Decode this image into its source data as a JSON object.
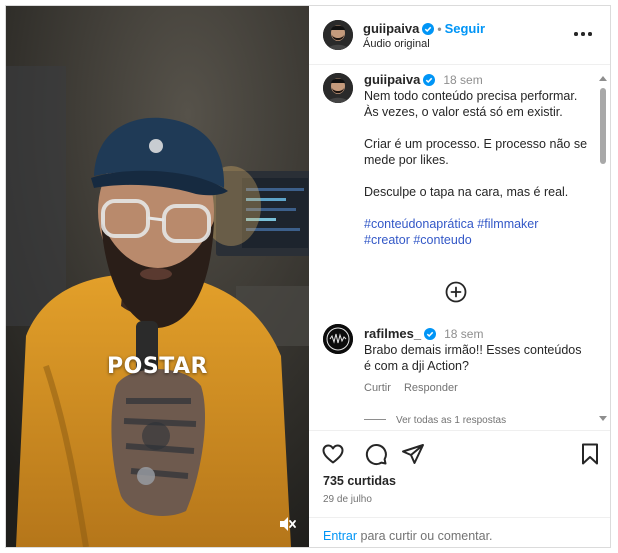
{
  "header": {
    "username": "guiipaiva",
    "separator": "•",
    "follow_label": "Seguir",
    "audio": "Áudio original"
  },
  "media": {
    "overlay_text": "POSTAR"
  },
  "caption": {
    "username": "guiipaiva",
    "time": "18 sem",
    "lines1": [
      "Nem todo conteúdo precisa performar.",
      "Às vezes, o valor está só em existir."
    ],
    "lines2": [
      "Criar é um processo. E processo não se",
      "mede por likes."
    ],
    "lines3": [
      "Desculpe o tapa na cara, mas é real."
    ],
    "hashtags_line1": [
      "#conteúdonaprática",
      "#filmmaker"
    ],
    "hashtags_line2": [
      "#creator",
      "#conteudo"
    ]
  },
  "comment": {
    "username": "rafilmes_",
    "time": "18 sem",
    "lines": [
      "Brabo demais irmão!! Esses conteúdos",
      "é com a dji Action?"
    ],
    "like_label": "Curtir",
    "reply_label": "Responder",
    "view_replies": "Ver todas as 1 respostas"
  },
  "actions": {
    "likes": "735 curtidas",
    "date": "29 de julho"
  },
  "login": {
    "link": "Entrar",
    "text": " para curtir ou comentar."
  },
  "colors": {
    "accent_blue": "#0095f6",
    "hashtag_blue": "#3358c7",
    "verified": "#0095f6",
    "sweater": "#d8901e",
    "cap": "#1f3a56"
  },
  "icons": [
    "verified-icon",
    "more-icon",
    "add-comment-icon",
    "heart-icon",
    "comment-icon",
    "share-icon",
    "bookmark-icon",
    "mute-icon"
  ]
}
